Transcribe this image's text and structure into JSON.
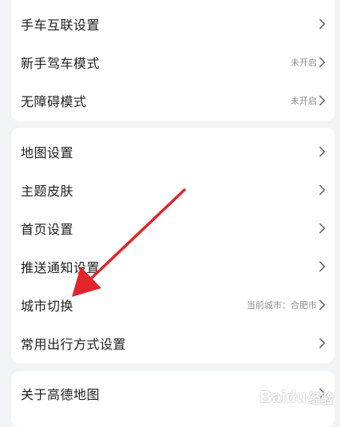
{
  "sections": [
    {
      "items": [
        {
          "label": "手车互联设置",
          "value": ""
        },
        {
          "label": "新手驾车模式",
          "value": "未开启"
        },
        {
          "label": "无障碍模式",
          "value": "未开启"
        }
      ]
    },
    {
      "items": [
        {
          "label": "地图设置",
          "value": ""
        },
        {
          "label": "主题皮肤",
          "value": ""
        },
        {
          "label": "首页设置",
          "value": ""
        },
        {
          "label": "推送通知设置",
          "value": ""
        },
        {
          "label": "城市切换",
          "value": "当前城市：合肥市"
        },
        {
          "label": "常用出行方式设置",
          "value": ""
        }
      ]
    },
    {
      "items": [
        {
          "label": "关于高德地图",
          "value": ""
        }
      ]
    }
  ],
  "icons": {
    "chevron": "chevron-right-icon"
  },
  "colors": {
    "annotation_arrow": "#e0262b",
    "background": "#f2f3f5"
  },
  "watermark": {
    "text": "Baidu",
    "sub": "经验"
  }
}
